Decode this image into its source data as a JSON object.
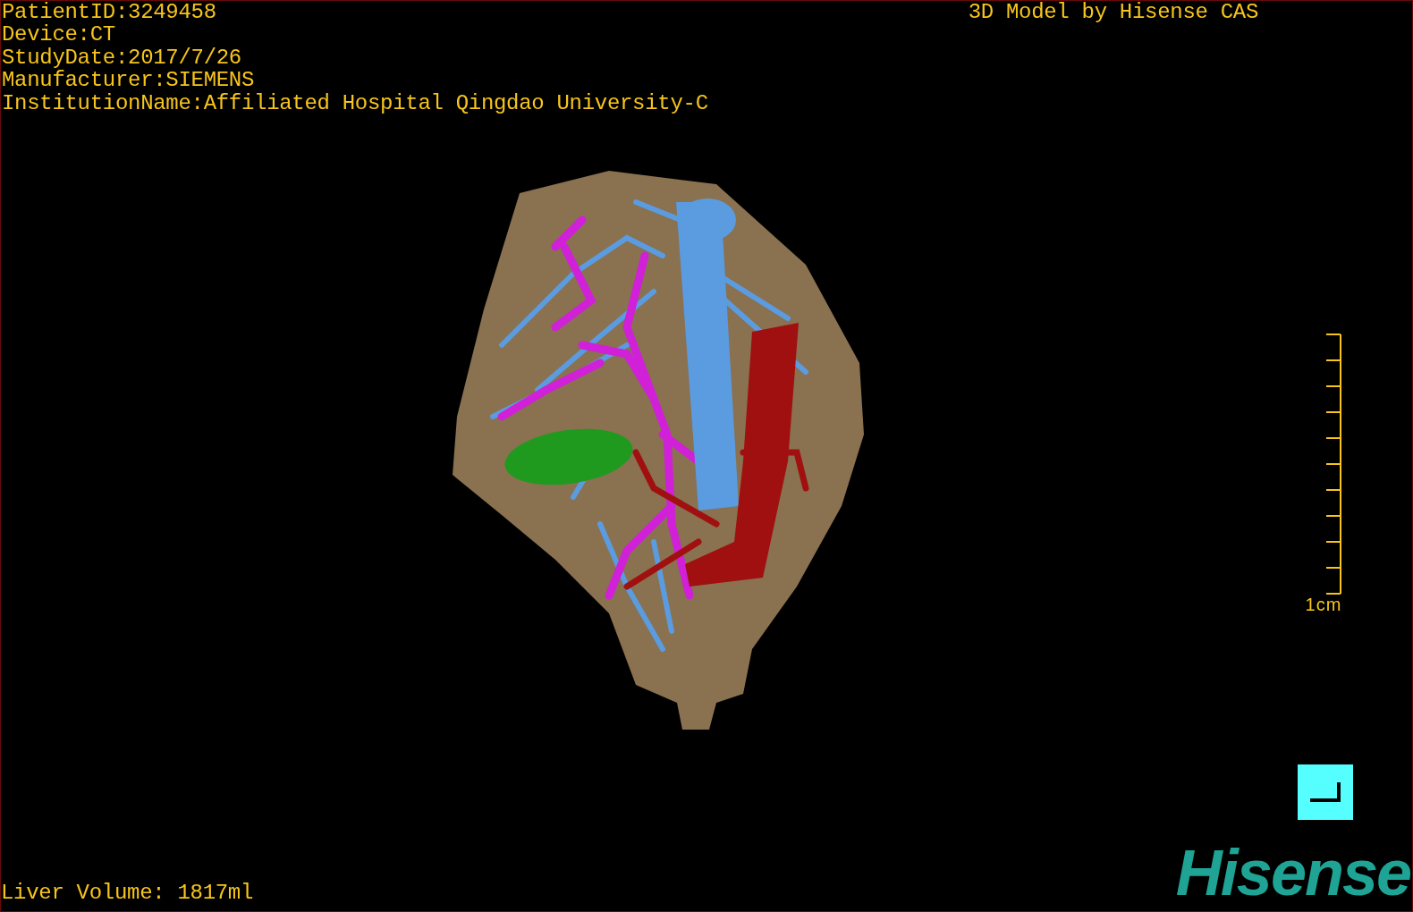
{
  "header": {
    "patient_info": [
      "PatientID:3249458",
      "Device:CT",
      "StudyDate:2017/7/26",
      "Manufacturer:SIEMENS",
      "InstitutionName:Affiliated Hospital Qingdao University-C"
    ],
    "title": "3D Model by Hisense CAS"
  },
  "scale_bar": {
    "label": "1cm"
  },
  "footer": {
    "liver_volume": "Liver Volume: 1817ml"
  },
  "logo": "Hisense"
}
